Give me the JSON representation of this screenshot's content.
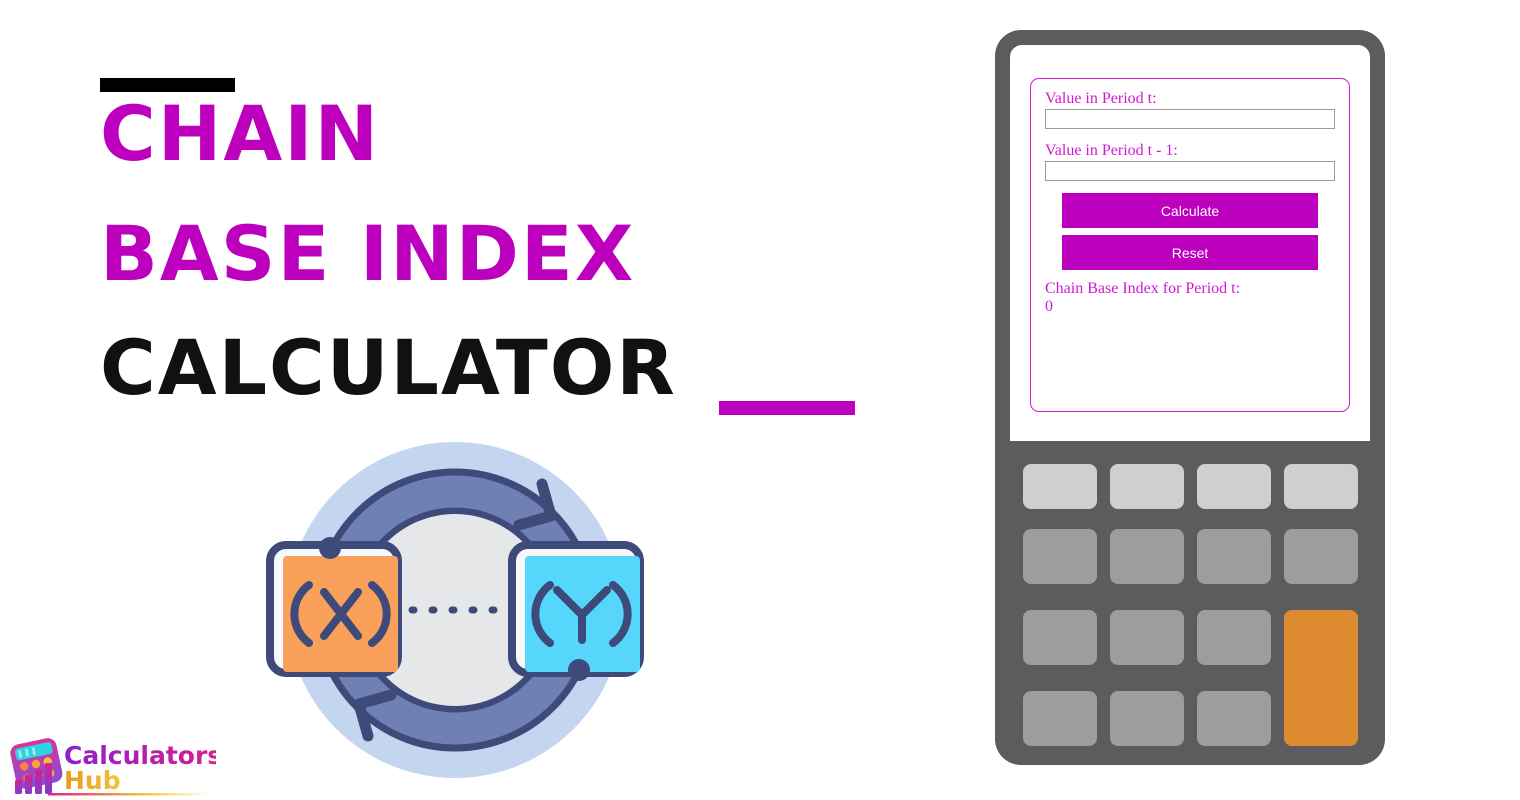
{
  "page": {
    "background": "#ffffff"
  },
  "title": {
    "line1": "CHAIN",
    "line2": "BASE INDEX",
    "line3": "CALCULATOR",
    "accent_color": "#BD00BD",
    "dark_color": "#111111",
    "rule_top_color": "#000000",
    "rule_bottom_color": "#BD00BD"
  },
  "illustration": {
    "name": "exchange-cycle-illustration",
    "left_card_label": "(X)",
    "right_card_label": "(Y)",
    "left_card_color": "#F9A05A",
    "right_card_color": "#55D6FA",
    "ring_color": "#6F81B4",
    "outer_circle_color": "#C4D5EF",
    "inner_circle_color": "#E6E7E9",
    "stroke_color": "#3D4A7A"
  },
  "brand": {
    "name_part1": "Calculators",
    "name_part2": "Hub",
    "part1_color": "#A81EC8",
    "part2_color": "#F0A020"
  },
  "calculator": {
    "device_color": "#5C5C5E",
    "screen_color": "#ffffff",
    "form_border_color": "#D119D1",
    "fields": [
      {
        "name": "value-period-t",
        "label": "Value in Period t:",
        "value": "",
        "placeholder": ""
      },
      {
        "name": "value-period-t-minus-1",
        "label": "Value in Period t - 1:",
        "value": "",
        "placeholder": ""
      }
    ],
    "buttons": {
      "calculate_label": "Calculate",
      "reset_label": "Reset",
      "button_color": "#BD00BD",
      "button_text_color": "#ffffff"
    },
    "result": {
      "label": "Chain Base Index for Period t:",
      "value": "0"
    },
    "keypad": {
      "rows": 4,
      "cols": 4,
      "key_color": "#9D9D9F",
      "top_row_key_color": "#CFCFD0",
      "accent_key_color": "#DD8A31",
      "accent_key_position": "last-column-rows-3-4"
    }
  }
}
